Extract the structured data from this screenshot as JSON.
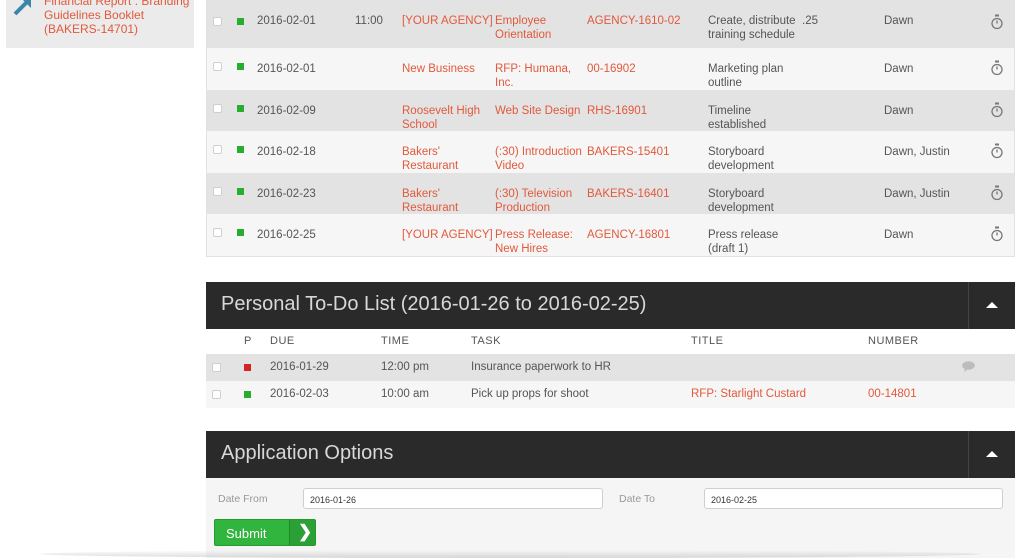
{
  "sidebar": {
    "link_lines": [
      "Financial Report : Branding",
      "Guidelines Booklet",
      "(BAKERS-14701)"
    ]
  },
  "tasks": [
    {
      "date": "2016-02-01",
      "time": "11:00",
      "client": "[YOUR AGENCY]",
      "job": [
        "Employee",
        "Orientation"
      ],
      "number": "AGENCY-1610-02",
      "task": [
        "Create, distribute",
        "training schedule"
      ],
      "hours": ".25",
      "assignee": "Dawn"
    },
    {
      "date": "2016-02-01",
      "time": "",
      "client": "New Business",
      "job": [
        "RFP: Humana,",
        "Inc."
      ],
      "number": "00-16902",
      "task": [
        "Marketing plan",
        "outline"
      ],
      "hours": "",
      "assignee": "Dawn"
    },
    {
      "date": "2016-02-09",
      "time": "",
      "client": [
        "Roosevelt High",
        "School"
      ],
      "job": [
        "Web Site Design"
      ],
      "number": "RHS-16901",
      "task": [
        "Timeline",
        "established"
      ],
      "hours": "",
      "assignee": "Dawn"
    },
    {
      "date": "2016-02-18",
      "time": "",
      "client": [
        "Bakers'",
        "Restaurant"
      ],
      "job": [
        "(:30) Introduction",
        "Video"
      ],
      "number": "BAKERS-15401",
      "task": [
        "Storyboard",
        "development"
      ],
      "hours": "",
      "assignee": "Dawn, Justin"
    },
    {
      "date": "2016-02-23",
      "time": "",
      "client": [
        "Bakers'",
        "Restaurant"
      ],
      "job": [
        "(:30) Television",
        "Production"
      ],
      "number": "BAKERS-16401",
      "task": [
        "Storyboard",
        "development"
      ],
      "hours": "",
      "assignee": "Dawn, Justin"
    },
    {
      "date": "2016-02-25",
      "time": "",
      "client": "[YOUR AGENCY]",
      "job": [
        "Press Release:",
        "New Hires"
      ],
      "number": "AGENCY-16801",
      "task": [
        "Press release",
        "(draft 1)"
      ],
      "hours": "",
      "assignee": "Dawn"
    }
  ],
  "todo": {
    "title": "Personal To-Do List (2016-01-26 to 2016-02-25)",
    "headers": {
      "p": "P",
      "due": "DUE",
      "time": "TIME",
      "task": "TASK",
      "title": "TITLE",
      "number": "NUMBER"
    },
    "rows": [
      {
        "priority": "red",
        "due": "2016-01-29",
        "time": "12:00 pm",
        "task": "Insurance paperwork to HR",
        "title": "",
        "number": "",
        "has_comment": true
      },
      {
        "priority": "green",
        "due": "2016-02-03",
        "time": "10:00 am",
        "task": "Pick up props for shoot",
        "title": "RFP: Starlight Custard",
        "number": "00-14801",
        "has_comment": false
      }
    ]
  },
  "options": {
    "title": "Application Options",
    "date_from_label": "Date From",
    "date_from_value": "2016-01-26",
    "date_to_label": "Date To",
    "date_to_value": "2016-02-25",
    "submit_label": "Submit",
    "submit_arrow": "❯"
  },
  "colors": {
    "accent": "#e2593b",
    "green": "#27ae2f",
    "red": "#d42424",
    "panel": "#2a2a2a",
    "submit": "#32b53f"
  },
  "icons": {
    "sidebar": "arrow-up-right-icon",
    "task_action": "stopwatch-icon",
    "comment": "comment-bubble-icon",
    "collapse": "caret-up-icon"
  }
}
